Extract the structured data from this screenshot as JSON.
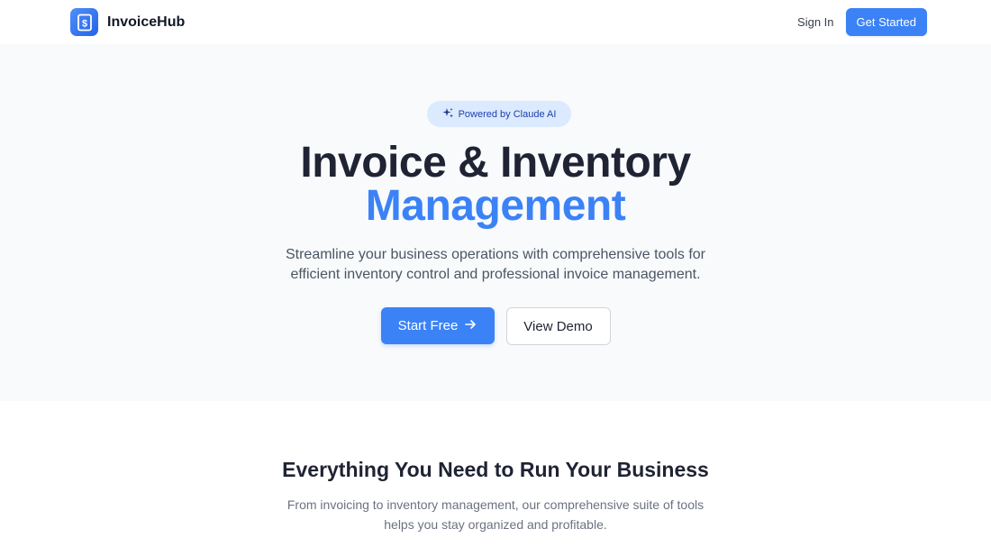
{
  "nav": {
    "brand": "InvoiceHub",
    "sign_in": "Sign In",
    "get_started": "Get Started"
  },
  "hero": {
    "badge": "Powered by Claude AI",
    "title_line1": "Invoice & Inventory",
    "title_line2": "Management",
    "subtitle_line1": "Streamline your business operations with comprehensive tools for",
    "subtitle_line2": "efficient inventory control and professional invoice management.",
    "start_free": "Start Free",
    "view_demo": "View Demo"
  },
  "features": {
    "title": "Everything You Need to Run Your Business",
    "subtitle_line1": "From invoicing to inventory management, our comprehensive suite of tools",
    "subtitle_line2": "helps you stay organized and profitable."
  },
  "icons": {
    "logo": "dollar-document-icon",
    "badge": "sparkles-icon",
    "start": "arrow-right-icon"
  },
  "colors": {
    "accent": "#3b82f6",
    "badge_bg": "#dbeafe",
    "heading": "#1f2333"
  }
}
